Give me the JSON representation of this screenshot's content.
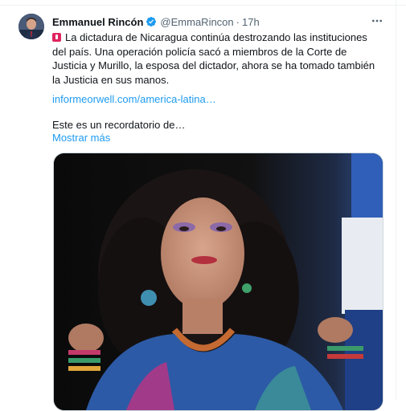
{
  "tweet": {
    "author_name": "Emmanuel Rincón",
    "handle": "@EmmaRincon",
    "separator": "·",
    "time": "17h",
    "body": "La dictadura de Nicaragua continúa destrozando las instituciones del país. Una operación policía sacó a miembros de la Corte de Justicia y Murillo, la esposa del dictador, ahora se ha tomado también la Justicia en sus manos.",
    "link": "informeorwell.com/america-latina…",
    "reminder": "Este es un recordatorio de…",
    "show_more": "Mostrar más"
  },
  "icons": {
    "verified": "verified-badge-icon",
    "more": "more-options-icon",
    "siren": "rotating-light-emoji-icon"
  },
  "colors": {
    "accent": "#1d9bf0",
    "text": "#0f1419",
    "secondary": "#536471"
  }
}
